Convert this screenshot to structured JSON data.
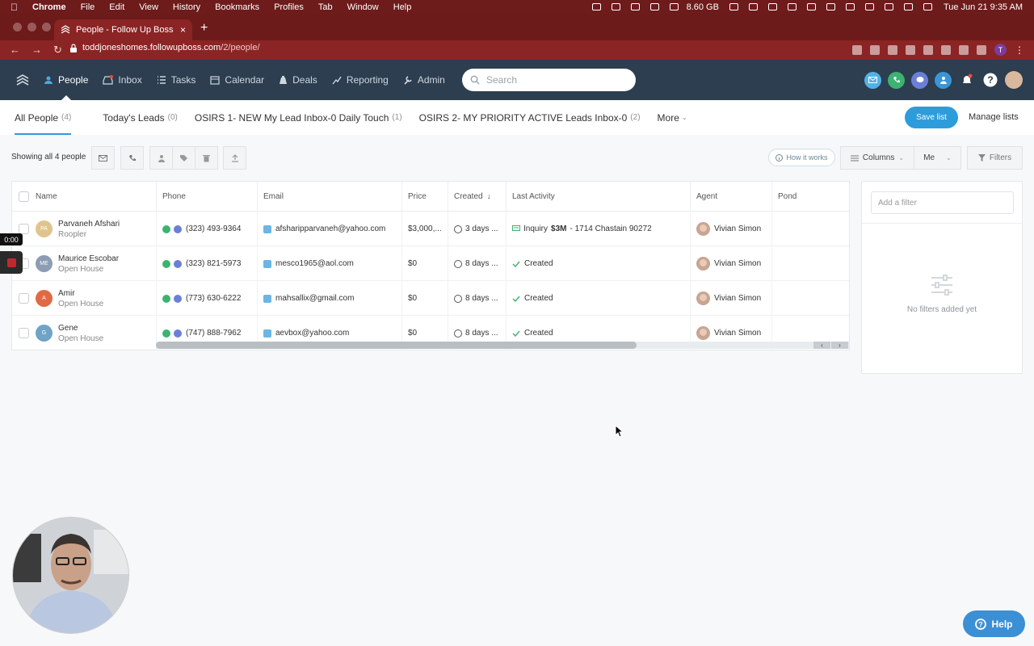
{
  "menubar": {
    "app": "Chrome",
    "items": [
      "File",
      "Edit",
      "View",
      "History",
      "Bookmarks",
      "Profiles",
      "Tab",
      "Window",
      "Help"
    ],
    "memory": "8.60 GB",
    "datetime": "Tue Jun 21  9:35 AM"
  },
  "browser": {
    "tab_title": "People - Follow Up Boss",
    "tab_close": "×",
    "new_tab": "+",
    "url_host": "toddjoneshomes.followupboss.com",
    "url_path": "/2/people/",
    "profile_initial": "T"
  },
  "appnav": {
    "items": [
      {
        "label": "People",
        "icon": "person-icon"
      },
      {
        "label": "Inbox",
        "icon": "inbox-icon"
      },
      {
        "label": "Tasks",
        "icon": "tasks-icon"
      },
      {
        "label": "Calendar",
        "icon": "calendar-icon"
      },
      {
        "label": "Deals",
        "icon": "deals-icon"
      },
      {
        "label": "Reporting",
        "icon": "reporting-icon"
      },
      {
        "label": "Admin",
        "icon": "admin-icon"
      }
    ],
    "search_placeholder": "Search"
  },
  "subnav": {
    "lists": [
      {
        "label": "All People",
        "count": "(4)"
      },
      {
        "label": "Today's Leads",
        "count": "(0)"
      },
      {
        "label": "OSIRS 1- NEW My Lead Inbox-0 Daily Touch",
        "count": "(1)"
      },
      {
        "label": "OSIRS 2- MY PRIORITY ACTIVE Leads Inbox-0",
        "count": "(2)"
      }
    ],
    "more": "More",
    "save_list": "Save list",
    "manage_lists": "Manage lists"
  },
  "toolbar": {
    "showing": "Showing all 4 people",
    "how_it_works": "How it works",
    "columns": "Columns",
    "me": "Me",
    "filters": "Filters"
  },
  "table": {
    "headers": [
      "Name",
      "Phone",
      "Email",
      "Price",
      "Created",
      "Last Activity",
      "Agent",
      "Pond"
    ],
    "rows": [
      {
        "initials": "PA",
        "avatar_color": "#e0c48e",
        "name": "Parvaneh Afshari",
        "source": "Roopler",
        "phone": "(323) 493-9364",
        "email": "afsharipparvaneh@yahoo.com",
        "price": "$3,000,...",
        "created": "3 days ...",
        "activity_prefix": "Inquiry",
        "activity_bold": "$3M",
        "activity_rest": "- 1714 Chastain 90272",
        "agent": "Vivian Simon"
      },
      {
        "initials": "ME",
        "avatar_color": "#8c9cb3",
        "name": "Maurice Escobar",
        "source": "Open House",
        "phone": "(323) 821-5973",
        "email": "mesco1965@aol.com",
        "price": "$0",
        "created": "8 days ...",
        "activity_prefix": "Created",
        "activity_bold": "",
        "activity_rest": "",
        "agent": "Vivian Simon"
      },
      {
        "initials": "A",
        "avatar_color": "#e06a45",
        "name": "Amir",
        "source": "Open House",
        "phone": "(773) 630-6222",
        "email": "mahsallix@gmail.com",
        "price": "$0",
        "created": "8 days ...",
        "activity_prefix": "Created",
        "activity_bold": "",
        "activity_rest": "",
        "agent": "Vivian Simon"
      },
      {
        "initials": "G",
        "avatar_color": "#6fa3c7",
        "name": "Gene",
        "source": "Open House",
        "phone": "(747) 888-7962",
        "email": "aevbox@yahoo.com",
        "price": "$0",
        "created": "8 days ...",
        "activity_prefix": "Created",
        "activity_bold": "",
        "activity_rest": "",
        "agent": "Vivian Simon"
      }
    ]
  },
  "filter_panel": {
    "placeholder": "Add a filter",
    "empty": "No filters added yet"
  },
  "recorder": {
    "time": "0:00"
  },
  "help_button": "Help",
  "colors": {
    "nav_bg": "#2c3e50",
    "accent": "#2d9cdb",
    "chrome_frame": "#6d1a1a"
  }
}
